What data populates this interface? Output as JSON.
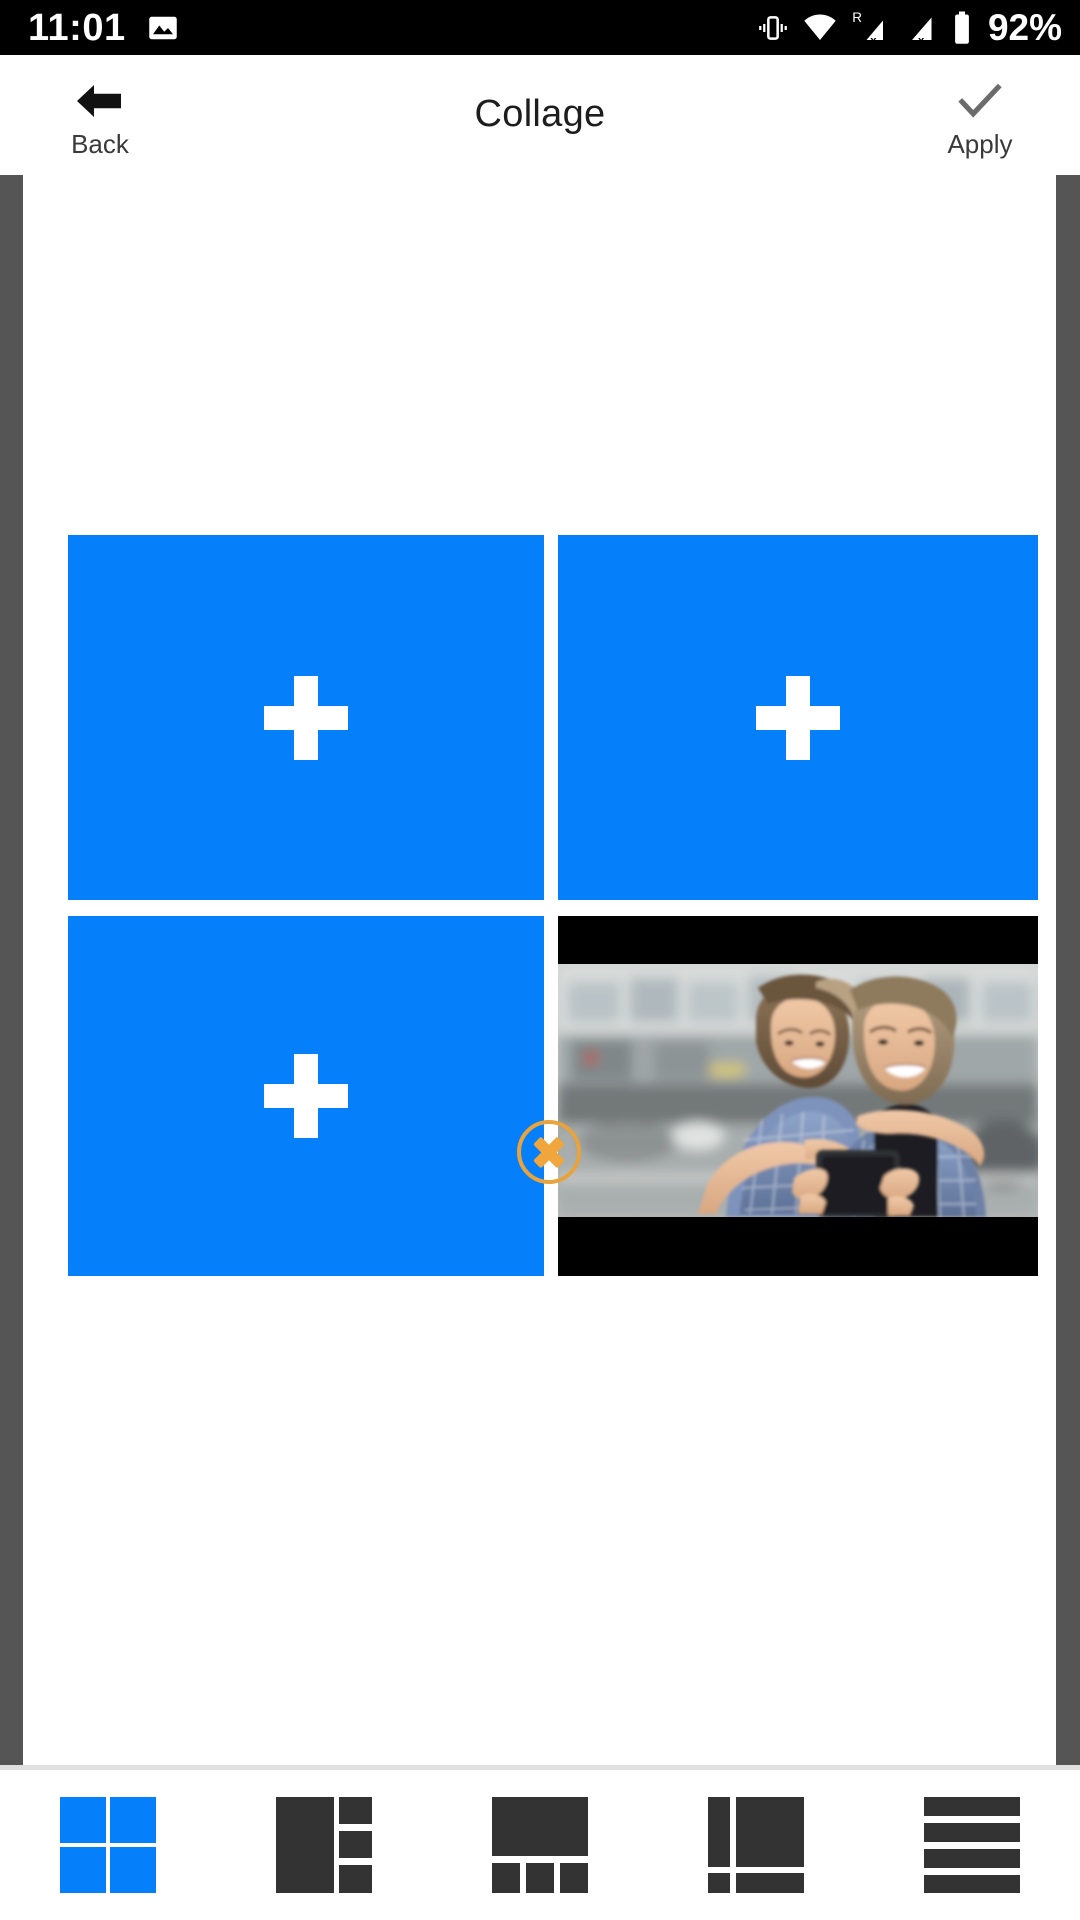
{
  "status_bar": {
    "time": "11:01",
    "battery_percent": "92%",
    "left_icons": [
      "image-icon"
    ],
    "right_icons": [
      "vibrate-icon",
      "wifi-icon",
      "roaming-signal-no-sim-icon",
      "signal-no-sim-icon",
      "battery-icon"
    ]
  },
  "header": {
    "title": "Collage",
    "back_label": "Back",
    "back_icon": "arrow-left-icon",
    "apply_label": "Apply",
    "apply_icon": "check-icon"
  },
  "editor": {
    "selected_layout_index": 0,
    "handle_icon": "close-x-circle-icon",
    "cells": [
      {
        "index": 1,
        "state": "empty",
        "icon": "plus-icon",
        "fill": "#0680FA"
      },
      {
        "index": 2,
        "state": "empty",
        "icon": "plus-icon",
        "fill": "#0680FA"
      },
      {
        "index": 3,
        "state": "empty",
        "icon": "plus-icon",
        "fill": "#0680FA"
      },
      {
        "index": 4,
        "state": "filled",
        "icon": "photo-thumbnail",
        "fill": "#000000",
        "description": "Smiling young couple outdoors, woman hugging man from behind while both look at a smartphone"
      }
    ]
  },
  "toolbar": {
    "templates": [
      {
        "name": "layout-grid-2x2",
        "selected": true
      },
      {
        "name": "layout-left-big-three-right",
        "selected": false
      },
      {
        "name": "layout-top-big-three-bottom",
        "selected": false
      },
      {
        "name": "layout-left-column-big-right",
        "selected": false
      },
      {
        "name": "layout-four-rows",
        "selected": false
      }
    ]
  },
  "colors": {
    "accent_blue": "#0680FA",
    "handle_orange": "#E8A33D",
    "rail_gray": "#555555",
    "toolbar_icon": "#333333"
  }
}
